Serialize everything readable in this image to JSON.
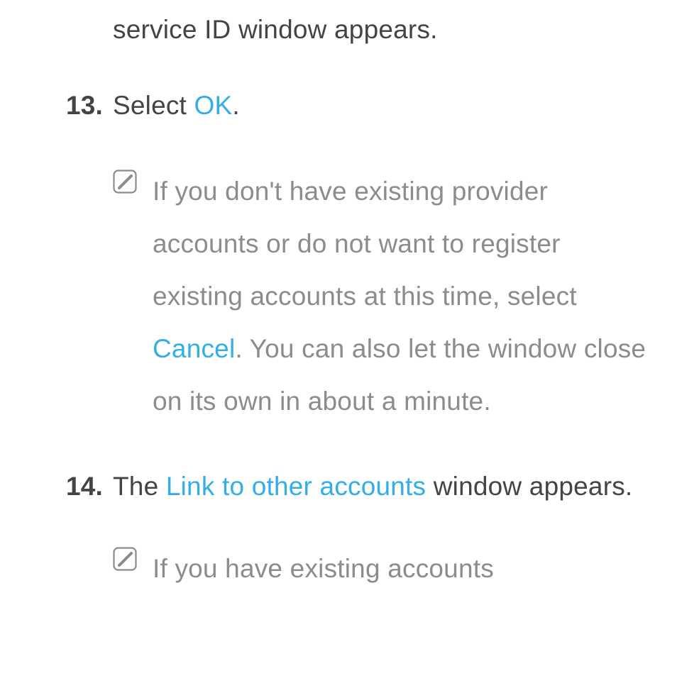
{
  "colors": {
    "link": "#33aee6",
    "body": "#444444",
    "note": "#8c8c8c"
  },
  "prev_tail": "service ID window appears.",
  "steps": [
    {
      "number": "13.",
      "segments": [
        {
          "text": "Select ",
          "link": false
        },
        {
          "text": "OK",
          "link": true
        },
        {
          "text": ".",
          "link": false
        }
      ],
      "note": {
        "segments": [
          {
            "text": "If you don't have existing provider accounts or do not want to register existing accounts at this time, select ",
            "link": false
          },
          {
            "text": "Cancel",
            "link": true
          },
          {
            "text": ". You can also let the window close on its own in about a minute.",
            "link": false
          }
        ]
      }
    },
    {
      "number": "14.",
      "segments": [
        {
          "text": "The ",
          "link": false
        },
        {
          "text": "Link to other accounts",
          "link": true
        },
        {
          "text": " window appears.",
          "link": false
        }
      ],
      "note": {
        "segments": [
          {
            "text": "If you have existing accounts",
            "link": false
          }
        ]
      }
    }
  ]
}
